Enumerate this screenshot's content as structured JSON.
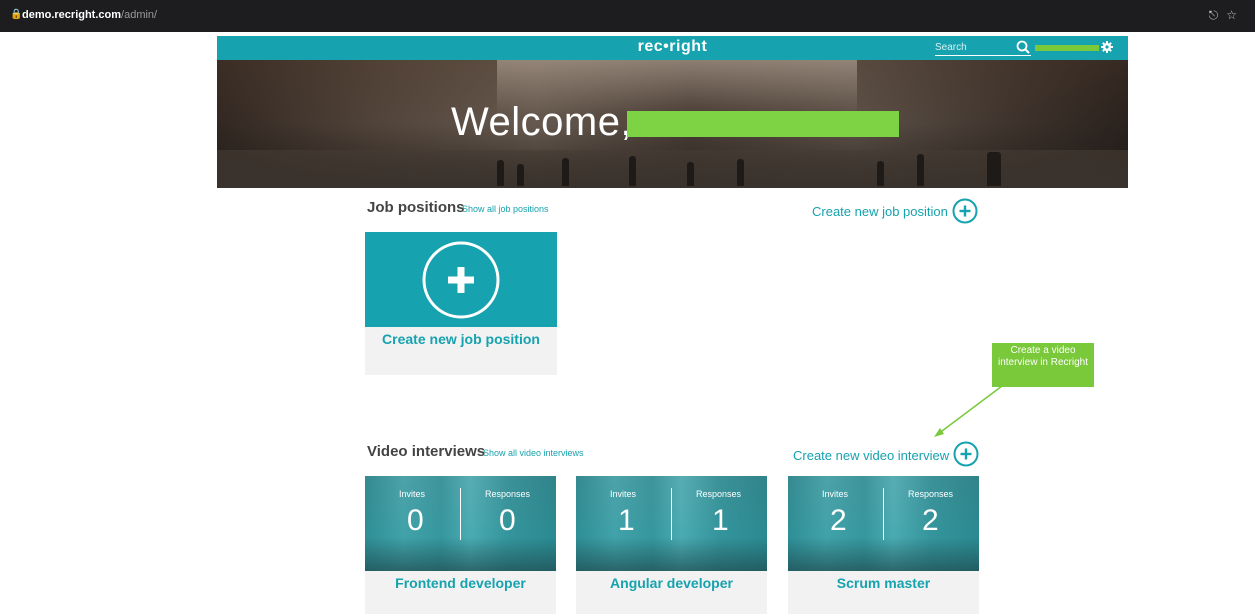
{
  "browser": {
    "url_host": "demo.recright.com",
    "url_path": "/admin/",
    "icons": [
      "share-icon",
      "star-icon"
    ]
  },
  "header": {
    "logo": "rec•right",
    "search_placeholder": "Search"
  },
  "hero": {
    "welcome": "Welcome,"
  },
  "job_positions": {
    "title": "Job positions",
    "show_all": "Show all job positions",
    "create_link": "Create new job position",
    "card_label": "Create new job position"
  },
  "annotation": {
    "text": "Create a video interview in Recright",
    "color": "#79c93a"
  },
  "video_interviews": {
    "title": "Video interviews",
    "show_all": "Show all video interviews",
    "create_link": "Create new video interview",
    "invites_label": "Invites",
    "responses_label": "Responses",
    "cards": [
      {
        "name": "Frontend developer",
        "invites": "0",
        "responses": "0"
      },
      {
        "name": "Angular developer",
        "invites": "1",
        "responses": "1"
      },
      {
        "name": "Scrum master",
        "invites": "2",
        "responses": "2"
      }
    ]
  },
  "colors": {
    "brand": "#16a2ae",
    "redaction": "#7ed344"
  }
}
